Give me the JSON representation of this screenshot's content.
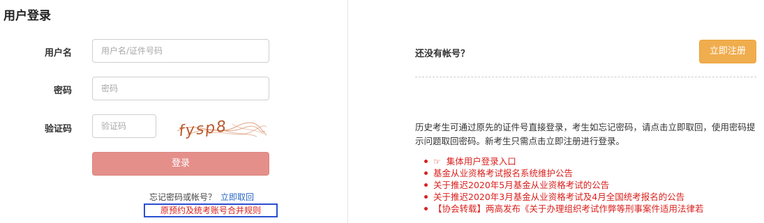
{
  "login": {
    "title": "用户登录",
    "username_label": "用户名",
    "username_placeholder": "用户名/证件号码",
    "password_label": "密码",
    "password_placeholder": "密码",
    "captcha_label": "验证码",
    "captcha_placeholder": "验证码",
    "captcha_text": "fysp8",
    "login_button": "登录",
    "forgot_text": "忘记密码或帐号？",
    "forgot_link": "立即取回",
    "merge_rules": "原预约及统考账号合并规则"
  },
  "register": {
    "no_account": "还没有帐号？",
    "register_button": "立即注册",
    "description": "历史考生可通过原先的证件号直接登录，考生如忘记密码，请点击立即取回，使用密码提示问题取回密码。新考生只需点击立即注册进行登录。"
  },
  "notices": [
    {
      "text": "集体用户登录入口",
      "icon": "pointing-hand-icon"
    },
    {
      "text": "基金从业资格考试报名系统维护公告"
    },
    {
      "text": "关于推迟2020年5月基金从业资格考试的公告"
    },
    {
      "text": "关于推迟2020年3月基金从业资格考试及4月全国统考报名的公告"
    },
    {
      "text": "【协会转载】两高发布《关于办理组织考试作弊等刑事案件适用法律若"
    }
  ],
  "colors": {
    "login_button": "#e58f8a",
    "register_button": "#f0ad4e",
    "link_red": "#d9211d",
    "link_blue": "#2a67c5",
    "highlight_box": "#2a4fd1"
  }
}
